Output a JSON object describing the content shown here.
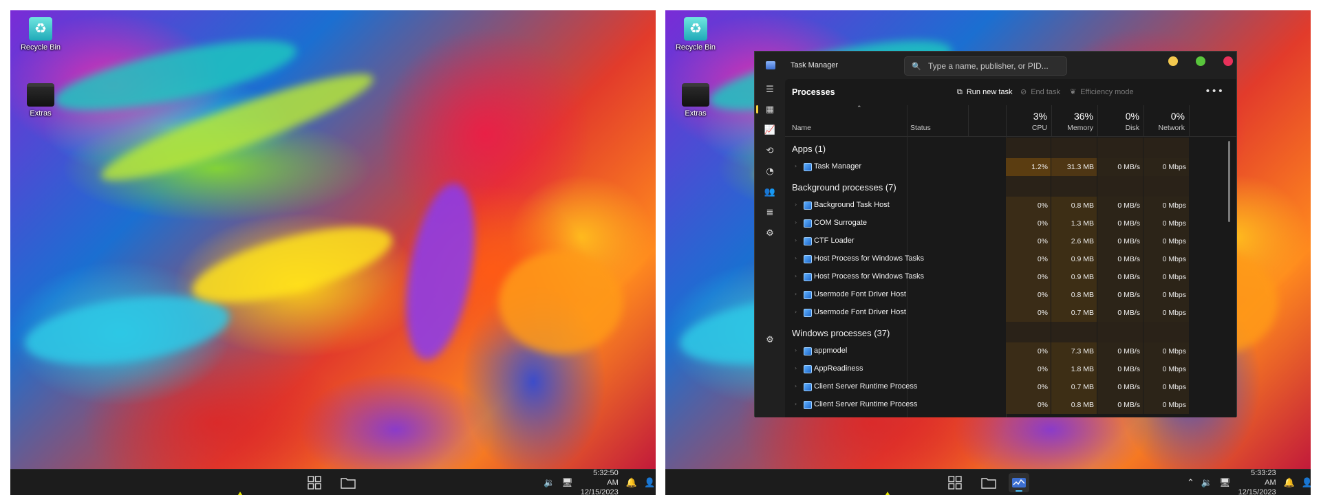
{
  "left": {
    "desktop": {
      "icons": [
        {
          "label": "Recycle Bin",
          "icon": "recycle-bin-icon"
        },
        {
          "label": "Extras",
          "icon": "folder-icon"
        }
      ]
    },
    "taskbar": {
      "time": "5:32:50 AM",
      "date": "12/15/2023"
    }
  },
  "right": {
    "desktop": {
      "icons": [
        {
          "label": "Recycle Bin",
          "icon": "recycle-bin-icon"
        },
        {
          "label": "Extras",
          "icon": "folder-icon"
        }
      ]
    },
    "taskbar": {
      "time": "5:33:23 AM",
      "date": "12/15/2023"
    },
    "task_manager": {
      "title": "Task Manager",
      "search_placeholder": "Type a name, publisher, or PID...",
      "page_title": "Processes",
      "commands": {
        "run_new_task": "Run new task",
        "end_task": "End task",
        "efficiency_mode": "Efficiency mode"
      },
      "window_colors": {
        "yellow": "#f3c94f",
        "green": "#59c53c",
        "red": "#e8315a"
      },
      "accent": "#f5d13c",
      "columns": {
        "name": "Name",
        "status": "Status",
        "cpu": {
          "pct": "3%",
          "label": "CPU"
        },
        "memory": {
          "pct": "36%",
          "label": "Memory"
        },
        "disk": {
          "pct": "0%",
          "label": "Disk"
        },
        "network": {
          "pct": "0%",
          "label": "Network"
        }
      },
      "groups": [
        {
          "label": "Apps (1)",
          "rows": [
            {
              "name": "Task Manager",
              "cpu": "1.2%",
              "memory": "31.3 MB",
              "disk": "0 MB/s",
              "network": "0 Mbps"
            }
          ]
        },
        {
          "label": "Background processes (7)",
          "rows": [
            {
              "name": "Background Task Host",
              "cpu": "0%",
              "memory": "0.8 MB",
              "disk": "0 MB/s",
              "network": "0 Mbps"
            },
            {
              "name": "COM Surrogate",
              "cpu": "0%",
              "memory": "1.3 MB",
              "disk": "0 MB/s",
              "network": "0 Mbps"
            },
            {
              "name": "CTF Loader",
              "cpu": "0%",
              "memory": "2.6 MB",
              "disk": "0 MB/s",
              "network": "0 Mbps"
            },
            {
              "name": "Host Process for Windows Tasks",
              "cpu": "0%",
              "memory": "0.9 MB",
              "disk": "0 MB/s",
              "network": "0 Mbps"
            },
            {
              "name": "Host Process for Windows Tasks",
              "cpu": "0%",
              "memory": "0.9 MB",
              "disk": "0 MB/s",
              "network": "0 Mbps"
            },
            {
              "name": "Usermode Font Driver Host",
              "cpu": "0%",
              "memory": "0.8 MB",
              "disk": "0 MB/s",
              "network": "0 Mbps"
            },
            {
              "name": "Usermode Font Driver Host",
              "cpu": "0%",
              "memory": "0.7 MB",
              "disk": "0 MB/s",
              "network": "0 Mbps"
            }
          ]
        },
        {
          "label": "Windows processes (37)",
          "rows": [
            {
              "name": "appmodel",
              "cpu": "0%",
              "memory": "7.3 MB",
              "disk": "0 MB/s",
              "network": "0 Mbps"
            },
            {
              "name": "AppReadiness",
              "cpu": "0%",
              "memory": "1.8 MB",
              "disk": "0 MB/s",
              "network": "0 Mbps"
            },
            {
              "name": "Client Server Runtime Process",
              "cpu": "0%",
              "memory": "0.7 MB",
              "disk": "0 MB/s",
              "network": "0 Mbps"
            },
            {
              "name": "Client Server Runtime Process",
              "cpu": "0%",
              "memory": "0.8 MB",
              "disk": "0 MB/s",
              "network": "0 Mbps"
            }
          ]
        }
      ]
    }
  }
}
